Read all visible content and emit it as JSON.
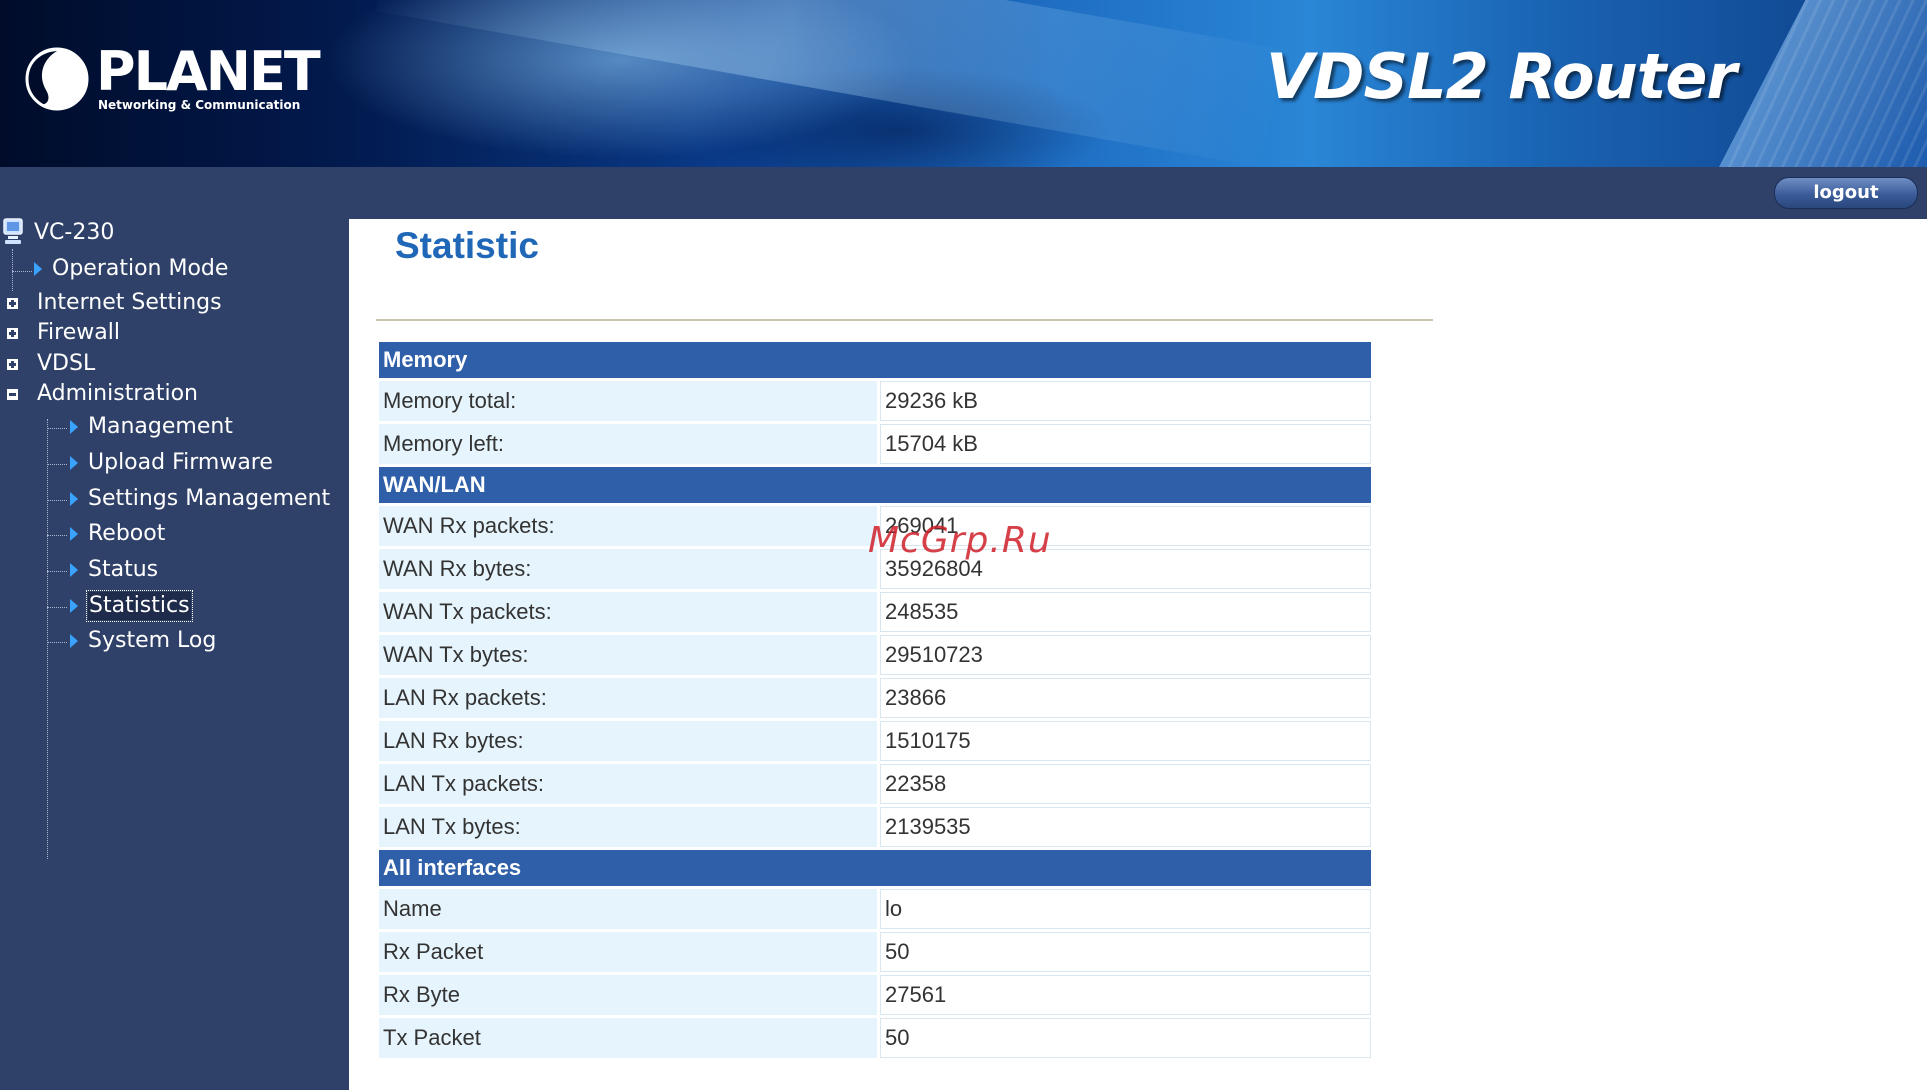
{
  "header": {
    "brand_name": "PLANET",
    "brand_tagline": "Networking & Communication",
    "product_title": "VDSL2 Router"
  },
  "topbar": {
    "logout_label": "logout"
  },
  "sidebar": {
    "root": "VC-230",
    "operation_mode": "Operation Mode",
    "internet_settings": "Internet Settings",
    "firewall": "Firewall",
    "vdsl": "VDSL",
    "administration": "Administration",
    "admin_items": [
      "Management",
      "Upload Firmware",
      "Settings Management",
      "Reboot",
      "Status",
      "Statistics",
      "System Log"
    ],
    "selected": "Statistics"
  },
  "main": {
    "title": "Statistic",
    "sections": [
      {
        "header": "Memory",
        "rows": [
          {
            "label": "Memory total:",
            "value": "29236 kB"
          },
          {
            "label": "Memory left:",
            "value": "15704 kB"
          }
        ]
      },
      {
        "header": "WAN/LAN",
        "rows": [
          {
            "label": "WAN Rx packets:",
            "value": "269041"
          },
          {
            "label": "WAN Rx bytes:",
            "value": "35926804"
          },
          {
            "label": "WAN Tx packets:",
            "value": "248535"
          },
          {
            "label": "WAN Tx bytes:",
            "value": "29510723"
          },
          {
            "label": "LAN Rx packets:",
            "value": "23866"
          },
          {
            "label": "LAN Rx bytes:",
            "value": "1510175"
          },
          {
            "label": "LAN Tx packets:",
            "value": "22358"
          },
          {
            "label": "LAN Tx bytes:",
            "value": "2139535"
          }
        ]
      },
      {
        "header": "All interfaces",
        "rows": [
          {
            "label": "Name",
            "value": "lo"
          },
          {
            "label": "Rx Packet",
            "value": "50"
          },
          {
            "label": "Rx Byte",
            "value": "27561"
          },
          {
            "label": "Tx Packet",
            "value": "50"
          }
        ]
      }
    ]
  },
  "watermark": "McGrp.Ru",
  "colors": {
    "sidebar_bg": "#2f4168",
    "section_header_bg": "#2e5fa8",
    "label_cell_bg": "#e6f5fd",
    "title_color": "#2167b8",
    "tree_arrow": "#39a3ff"
  }
}
